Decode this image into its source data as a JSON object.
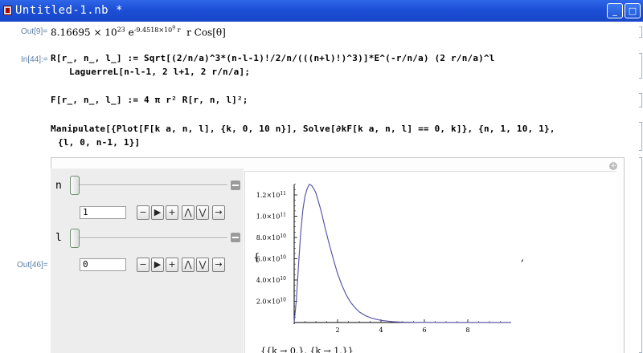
{
  "window": {
    "title": "Untitled-1.nb *",
    "minimize_glyph": "_",
    "maximize_glyph": "□"
  },
  "cells": {
    "out9_label": "Out[9]=",
    "out9_value": "8.16695 × 10",
    "out9_exp": "23",
    "out9_e": " e",
    "out9_eexp": "-9.4518×10",
    "out9_eexp2": "9",
    "out9_r": " r",
    "out9_tail": "  r Cos[θ]",
    "in44_label": "In[44]:=",
    "in44_line1": "R[r_, n_, l_] := Sqrt[(2/n/a)^3*(n-l-1)!/2/n/(((n+l)!)^3)]*E^(-r/n/a) (2 r/n/a)^l",
    "in44_line2": "LaguerreL[n-l-1, 2 l+1, 2 r/n/a];",
    "f_line": "F[r_, n_, l_] := 4 π r² R[r, n, l]²;",
    "manip_line1": "Manipulate[{Plot[F[k a, n, l], {k, 0, 10 n}], Solve[∂kF[k a, n, l] == 0, k]}, {n, 1, 10, 1},",
    "manip_line2": "{l, 0, n-1, 1}]",
    "out46_label": "Out[46]="
  },
  "manipulate": {
    "plus_glyph": "+",
    "controls": [
      {
        "name": "n",
        "value": "1"
      },
      {
        "name": "l",
        "value": "0"
      }
    ],
    "anim_buttons": {
      "minus": "−",
      "play": "▶",
      "plus": "+",
      "faster": "⋀",
      "slower": "⋁",
      "direction": "→"
    }
  },
  "plot": {
    "open_brace": "{",
    "comma": ",",
    "result_text": "{{k → 0.}, {k → 1.}}"
  },
  "chart_data": {
    "type": "line",
    "title": "",
    "xlabel": "",
    "ylabel": "",
    "xlim": [
      0,
      10
    ],
    "ylim": [
      0,
      135000000000.0
    ],
    "x_ticks": [
      2,
      4,
      6,
      8
    ],
    "x_tick_labels": [
      "2",
      "4",
      "6",
      "8"
    ],
    "y_ticks": [
      20000000000.0,
      40000000000.0,
      60000000000.0,
      80000000000.0,
      100000000000.0,
      120000000000.0
    ],
    "y_tick_labels": [
      "2.0×10",
      "4.0×10",
      "6.0×10",
      "8.0×10",
      "1.0×10",
      "1.2×10"
    ],
    "y_tick_exps": [
      "10",
      "10",
      "10",
      "10",
      "11",
      "11"
    ],
    "series": [
      {
        "color": "#5a5aa8",
        "x": [
          0,
          0.1,
          0.2,
          0.3,
          0.4,
          0.5,
          0.6,
          0.7,
          0.8,
          0.9,
          1.0,
          1.1,
          1.2,
          1.3,
          1.4,
          1.5,
          1.6,
          1.8,
          2.0,
          2.2,
          2.4,
          2.6,
          2.8,
          3.0,
          3.3,
          3.6,
          4.0,
          4.5,
          5.0,
          5.5,
          6.0,
          7.0,
          8.0,
          9.0,
          10.0
        ],
        "y": [
          0,
          21000000000.0,
          54000000000.0,
          84000000000.0,
          106000000000.0,
          119000000000.0,
          126000000000.0,
          130000000000.0,
          129000000000.0,
          126000000000.0,
          122000000000.0,
          115000000000.0,
          108000000000.0,
          100000000000.0,
          91000000000.0,
          83000000000.0,
          75000000000.0,
          60000000000.0,
          46000000000.0,
          35000000000.0,
          26000000000.0,
          19000000000.0,
          14000000000.0,
          10000000000.0,
          6300000000.0,
          3900000000.0,
          2000000000.0,
          800000000.0,
          300000000.0,
          120000000.0,
          40000000.0,
          5000000.0,
          700000.0,
          100000.0,
          10000.0
        ]
      }
    ]
  }
}
